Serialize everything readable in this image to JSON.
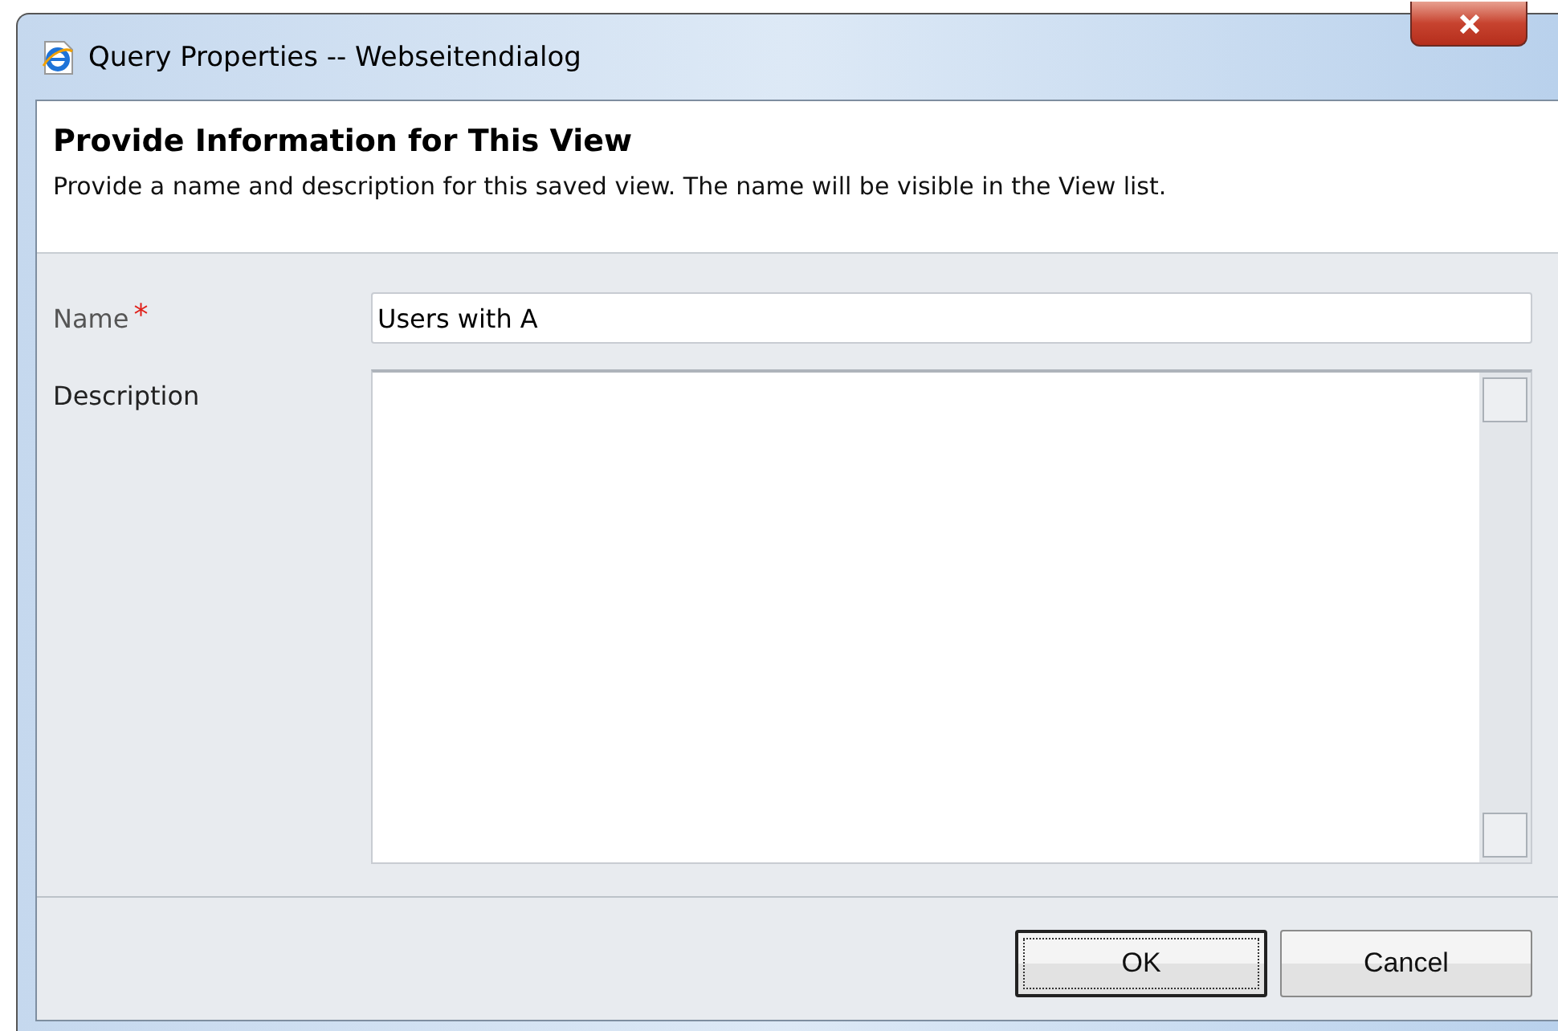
{
  "window": {
    "title": "Query Properties -- Webseitendialog"
  },
  "header": {
    "title": "Provide Information for This View",
    "description": "Provide a name and description for this saved view. The name will be visible in the View list."
  },
  "fields": [
    {
      "label": "Name",
      "required": true,
      "required_marker": "*",
      "kind": "text",
      "value": "Users with A"
    },
    {
      "label": "Description",
      "required": false,
      "kind": "textarea"
    }
  ],
  "buttons": [
    {
      "label": "OK",
      "default": true
    },
    {
      "label": "Cancel",
      "default": false
    }
  ]
}
